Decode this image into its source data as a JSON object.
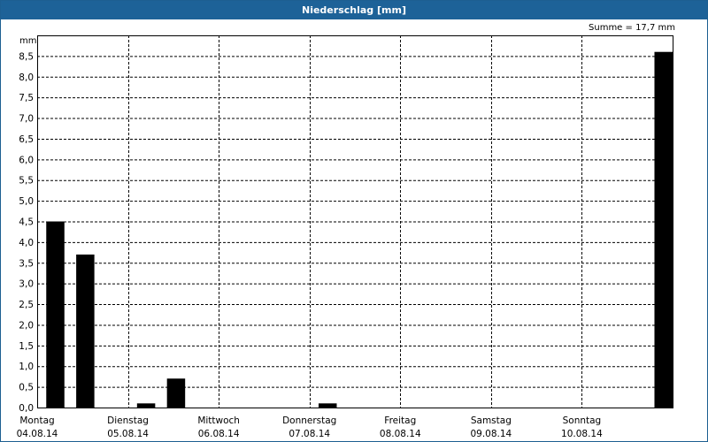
{
  "chart_data": {
    "type": "bar",
    "title": "Niederschlag [mm]",
    "ylabel": "mm",
    "summary": "Summe = 17,7 mm",
    "ylim": [
      0,
      9.0
    ],
    "yticks": [
      "0,0",
      "0,5",
      "1,0",
      "1,5",
      "2,0",
      "2,5",
      "3,0",
      "3,5",
      "4,0",
      "4,5",
      "5,0",
      "5,5",
      "6,0",
      "6,5",
      "7,0",
      "7,5",
      "8,0",
      "8,5"
    ],
    "days": [
      {
        "name": "Montag",
        "date": "04.08.14"
      },
      {
        "name": "Dienstag",
        "date": "05.08.14"
      },
      {
        "name": "Mittwoch",
        "date": "06.08.14"
      },
      {
        "name": "Donnerstag",
        "date": "07.08.14"
      },
      {
        "name": "Freitag",
        "date": "08.08.14"
      },
      {
        "name": "Samstag",
        "date": "09.08.14"
      },
      {
        "name": "Sonntag",
        "date": "10.08.14"
      }
    ],
    "x_range_days": [
      0,
      7
    ],
    "bar_width_days": 0.2,
    "bars": [
      {
        "day": 0.1,
        "value": 4.5
      },
      {
        "day": 0.43,
        "value": 3.7
      },
      {
        "day": 1.1,
        "value": 0.1
      },
      {
        "day": 1.43,
        "value": 0.7
      },
      {
        "day": 3.1,
        "value": 0.1
      },
      {
        "day": 6.8,
        "value": 8.6
      }
    ],
    "grid": true,
    "colors": {
      "bar": "#000000",
      "grid": "#000000",
      "title_bg": "#1d6298"
    }
  }
}
